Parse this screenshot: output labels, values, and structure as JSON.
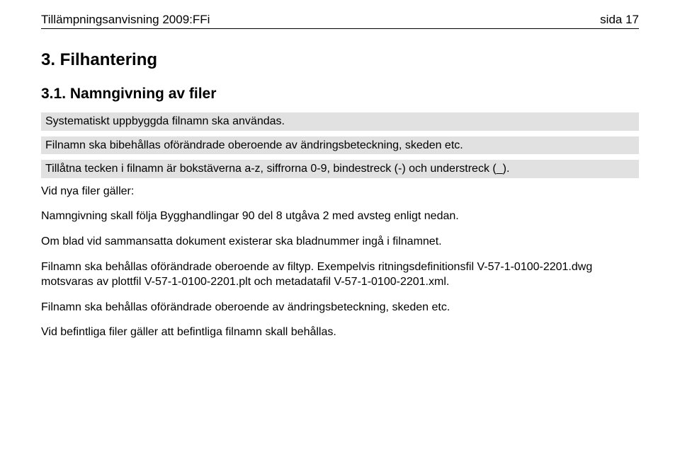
{
  "header": {
    "doc_title": "Tillämpningsanvisning 2009:FFi",
    "page_label": "sida 17"
  },
  "section": {
    "number_title": "3. Filhantering",
    "subsection_title": "3.1. Namngivning av filer"
  },
  "notes": {
    "p1": "Systematiskt uppbyggda filnamn ska användas.",
    "p2": "Filnamn ska bibehållas oförändrade oberoende av ändringsbeteckning, skeden etc.",
    "p3": "Tillåtna tecken i filnamn är bokstäverna a-z, siffrorna 0-9, bindestreck (-) och understreck (_)."
  },
  "body": {
    "p1": "Vid nya filer gäller:",
    "p2": "Namngivning skall följa Bygghandlingar 90 del 8 utgåva 2 med avsteg enligt nedan.",
    "p3": "Om blad vid sammansatta dokument existerar ska bladnummer ingå i filnamnet.",
    "p4": "Filnamn ska behållas oförändrade oberoende av filtyp. Exempelvis ritningsdefinitionsfil V-57-1-0100-2201.dwg motsvaras av plottfil V-57-1-0100-2201.plt och metadatafil V-57-1-0100-2201.xml.",
    "p5": "Filnamn ska behållas oförändrade oberoende av ändringsbeteckning, skeden etc.",
    "p6": "Vid befintliga filer gäller att befintliga filnamn skall behållas."
  }
}
